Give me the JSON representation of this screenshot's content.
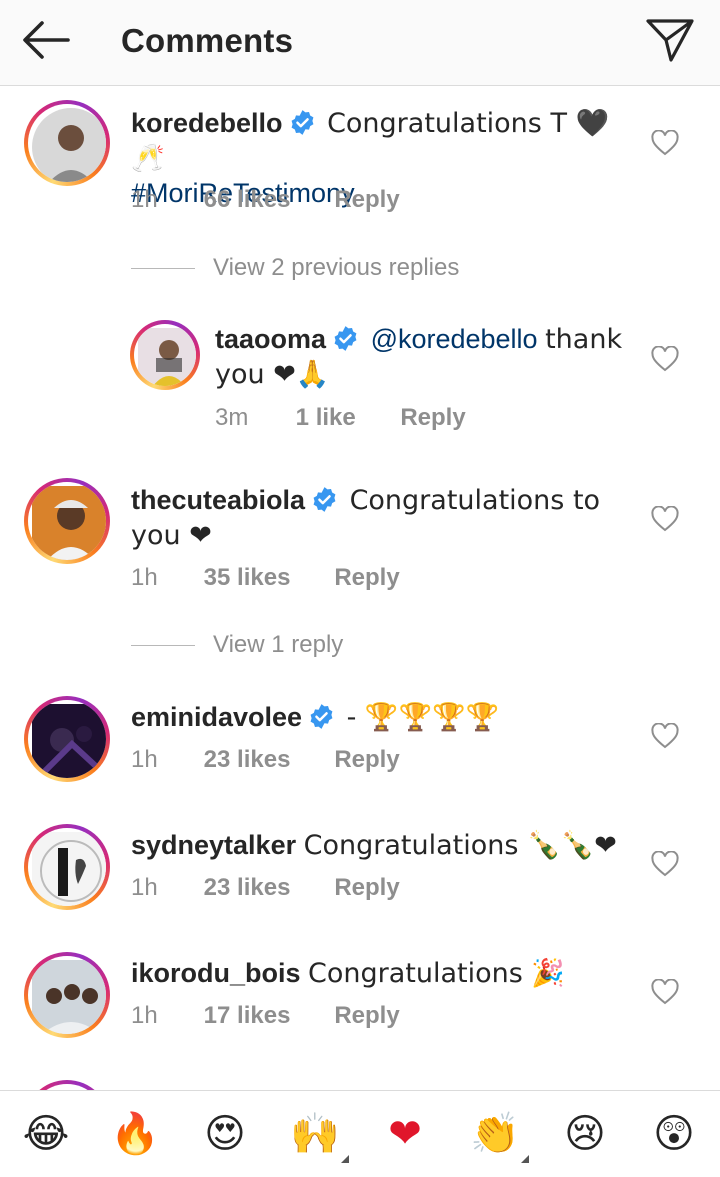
{
  "header": {
    "title": "Comments",
    "back_icon": "arrow-left-icon",
    "share_icon": "paper-plane-icon"
  },
  "comments": [
    {
      "username": "koredebello",
      "verified": true,
      "text": "Congratulations T 🖤🥂",
      "hashtag": "#MoriReTestimony",
      "time": "1h",
      "likes": "66 likes",
      "reply": "Reply"
    },
    {
      "username": "taaooma",
      "verified": true,
      "mention": "@koredebello",
      "text": "thank you ❤🙏",
      "time": "3m",
      "likes": "1 like",
      "reply": "Reply"
    },
    {
      "username": "thecuteabiola",
      "verified": true,
      "text": "Congratulations to you ❤",
      "time": "1h",
      "likes": "35 likes",
      "reply": "Reply"
    },
    {
      "username": "eminidavolee",
      "verified": true,
      "text": "- 🏆🏆🏆🏆",
      "time": "1h",
      "likes": "23 likes",
      "reply": "Reply"
    },
    {
      "username": "sydneytalker",
      "verified": false,
      "text": "Congratulations 🍾🍾❤",
      "time": "1h",
      "likes": "23 likes",
      "reply": "Reply"
    },
    {
      "username": "ikorodu_bois",
      "verified": false,
      "text": "Congratulations 🎉",
      "time": "1h",
      "likes": "17 likes",
      "reply": "Reply"
    }
  ],
  "view_previous_replies": "View 2 previous replies",
  "view_reply": "View 1 reply",
  "emoji_bar": [
    "😂",
    "🔥",
    "😍",
    "🙌",
    "❤",
    "👏",
    "😢",
    "😲"
  ],
  "colors": {
    "accent_link": "#003569",
    "verified_blue": "#3897f0",
    "heart_red": "#e0162b",
    "secondary_text": "#8e8e8e"
  }
}
